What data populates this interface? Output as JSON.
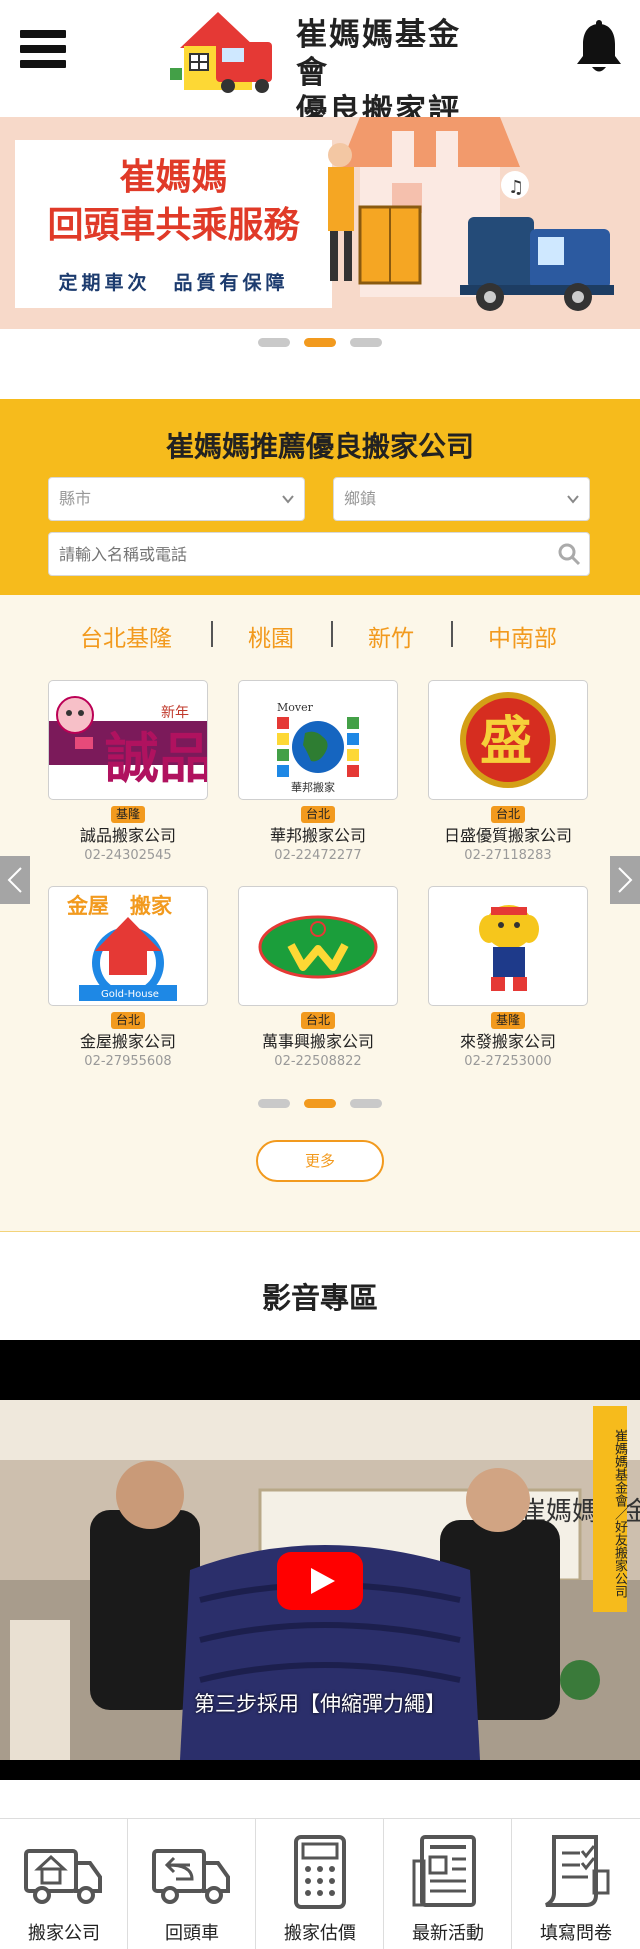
{
  "header": {
    "logo_line1": "崔媽媽基金會",
    "logo_line2": "優良搬家評鑑",
    "menu_icon": "hamburger-menu-icon",
    "bell_icon": "bell-icon"
  },
  "banner": {
    "title_line1": "崔媽媽",
    "title_line2": "回頭車共乘服務",
    "subtitle": "定期車次　品質有保障",
    "colors": {
      "background": "#f7d9c9",
      "title": "#e03a28",
      "subtitle": "#1c3b6e"
    }
  },
  "search": {
    "title": "崔媽媽推薦優良搬家公司",
    "city_placeholder": "縣市",
    "town_placeholder": "鄉鎮",
    "keyword_placeholder": "請輸入名稱或電話",
    "background_color": "#f6bb1c"
  },
  "regions": [
    "台北基隆",
    "桃園",
    "新竹",
    "中南部"
  ],
  "companies": [
    {
      "region": "基隆",
      "name": "誠品搬家公司",
      "phone": "02-24302545",
      "logo_text": "誠品",
      "logo_tag": "新年"
    },
    {
      "region": "台北",
      "name": "華邦搬家公司",
      "phone": "02-22472277",
      "logo_text": "華邦搬家",
      "logo_tag": "Mover"
    },
    {
      "region": "台北",
      "name": "日盛優質搬家公司",
      "phone": "02-27118283",
      "logo_text": "盛"
    },
    {
      "region": "台北",
      "name": "金屋搬家公司",
      "phone": "02-27955608",
      "logo_text": "金屋　搬家",
      "logo_tag": "Gold-House"
    },
    {
      "region": "台北",
      "name": "萬事興搬家公司",
      "phone": "02-22508822"
    },
    {
      "region": "基隆",
      "name": "來發搬家公司",
      "phone": "02-27253000"
    }
  ],
  "more_label": "更多",
  "video": {
    "section_title": "影音專區",
    "caption": "第三步採用【伸縮彈力繩】",
    "side_label": "崔媽媽基金會／好友搬家公司",
    "wall_text": "崔媽媽基金會"
  },
  "bottom_nav": [
    {
      "label": "搬家公司",
      "icon": "moving-truck-house-icon"
    },
    {
      "label": "回頭車",
      "icon": "return-truck-icon"
    },
    {
      "label": "搬家估價",
      "icon": "calculator-icon"
    },
    {
      "label": "最新活動",
      "icon": "newspaper-icon"
    },
    {
      "label": "填寫問卷",
      "icon": "survey-checklist-icon"
    }
  ],
  "accent_color": "#f29a1e"
}
